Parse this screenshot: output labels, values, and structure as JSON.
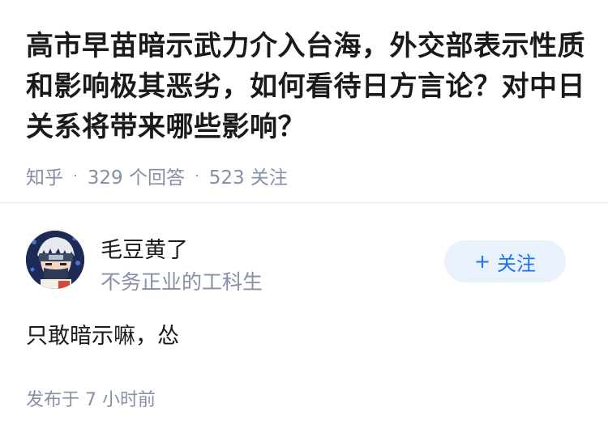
{
  "question": {
    "title": "高市早苗暗示武力介入台海，外交部表示性质和影响极其恶劣，如何看待日方言论？对中日关系将带来哪些影响？",
    "source": "知乎",
    "answer_count": "329 个回答",
    "follower_count": "523 关注"
  },
  "author": {
    "avatar_icon": "avatar-anime-character",
    "name": "毛豆黄了",
    "bio": "不务正业的工科生",
    "follow_plus": "+",
    "follow_label": "关注"
  },
  "answer": {
    "text": "只敢暗示嘛，怂",
    "published": "发布于 7 小时前"
  },
  "colors": {
    "accent": "#1772f6",
    "follow_bg": "#e9f2fc",
    "meta_gray": "#8590a6",
    "text": "#1a1a1a"
  }
}
